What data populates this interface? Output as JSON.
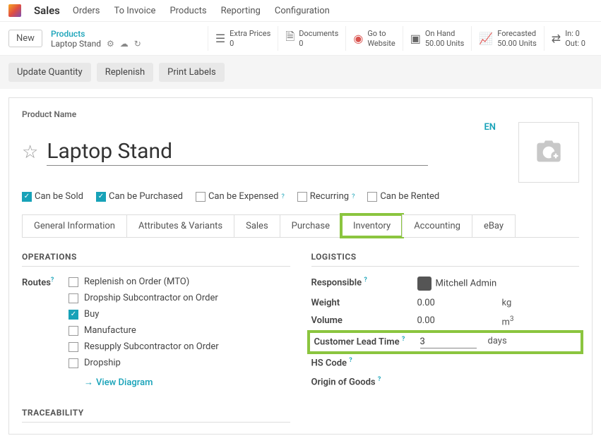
{
  "brand": "Sales",
  "topmenu": [
    "Orders",
    "To Invoice",
    "Products",
    "Reporting",
    "Configuration"
  ],
  "new_label": "New",
  "breadcrumb": {
    "root": "Products",
    "leaf": "Laptop Stand"
  },
  "stats": {
    "extra_prices": {
      "label": "Extra Prices",
      "value": "0"
    },
    "documents": {
      "label": "Documents",
      "value": "0"
    },
    "goto": {
      "label": "Go to",
      "value": "Website"
    },
    "onhand": {
      "label": "On Hand",
      "value": "50.00 Units"
    },
    "forecasted": {
      "label": "Forecasted",
      "value": "50.00 Units"
    },
    "inout": {
      "in": "In: 0",
      "out": "Out: 0"
    }
  },
  "actions": {
    "update": "Update Quantity",
    "replenish": "Replenish",
    "print": "Print Labels"
  },
  "form": {
    "name_label": "Product Name",
    "name": "Laptop Stand",
    "lang": "EN",
    "checks": {
      "sold": {
        "label": "Can be Sold",
        "on": true
      },
      "purchased": {
        "label": "Can be Purchased",
        "on": true
      },
      "expensed": {
        "label": "Can be Expensed",
        "on": false,
        "q": true
      },
      "recurring": {
        "label": "Recurring",
        "on": false,
        "q": true
      },
      "rented": {
        "label": "Can be Rented",
        "on": false
      }
    }
  },
  "tabs": [
    "General Information",
    "Attributes & Variants",
    "Sales",
    "Purchase",
    "Inventory",
    "Accounting",
    "eBay"
  ],
  "operations": {
    "title": "OPERATIONS",
    "routes_label": "Routes",
    "routes": [
      {
        "label": "Replenish on Order (MTO)",
        "on": false
      },
      {
        "label": "Dropship Subcontractor on Order",
        "on": false
      },
      {
        "label": "Buy",
        "on": true
      },
      {
        "label": "Manufacture",
        "on": false
      },
      {
        "label": "Resupply Subcontractor on Order",
        "on": false
      },
      {
        "label": "Dropship",
        "on": false
      }
    ],
    "view_diagram": "View Diagram"
  },
  "logistics": {
    "title": "LOGISTICS",
    "responsible_label": "Responsible",
    "responsible": "Mitchell Admin",
    "weight_label": "Weight",
    "weight": "0.00",
    "weight_unit": "kg",
    "volume_label": "Volume",
    "volume": "0.00",
    "volume_unit_html": "m³",
    "clt_label": "Customer Lead Time",
    "clt": "3",
    "clt_unit": "days",
    "hs_label": "HS Code",
    "origin_label": "Origin of Goods"
  },
  "traceability_title": "TRACEABILITY"
}
